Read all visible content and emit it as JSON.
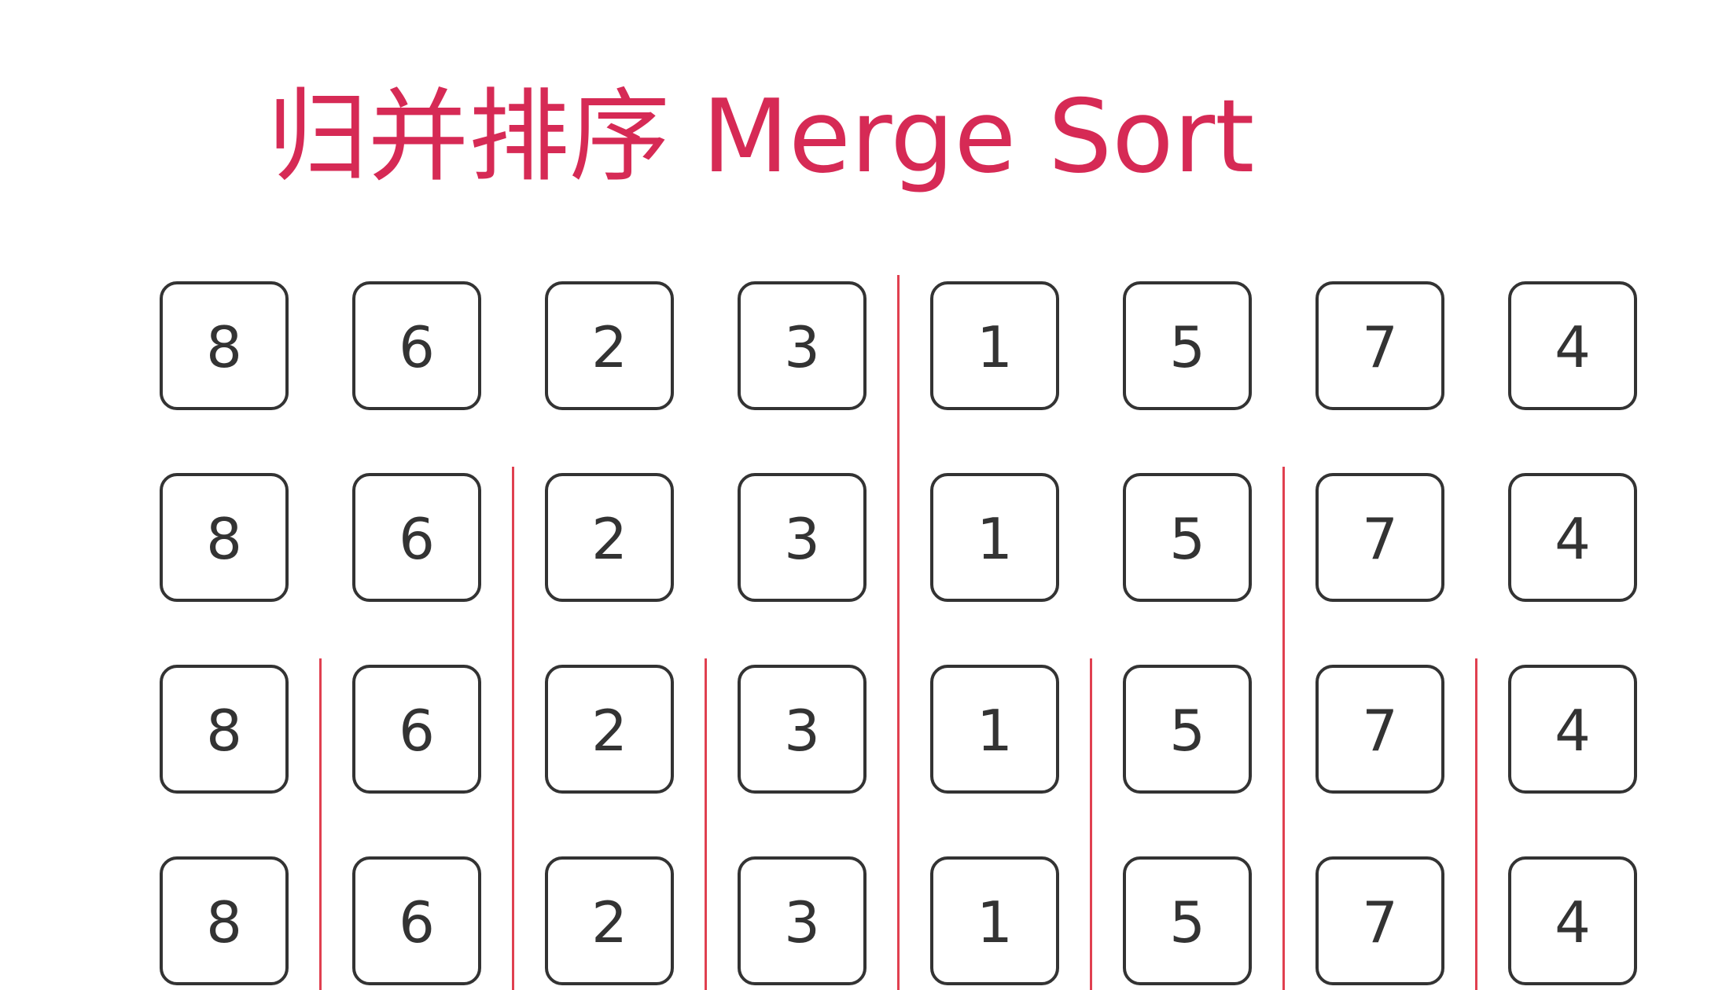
{
  "title": "归并排序 Merge Sort",
  "colors": {
    "title": "#d62a55",
    "divider": "#e04050",
    "cell_border": "#333333",
    "cell_text": "#333333"
  },
  "rows": [
    {
      "values": [
        "8",
        "6",
        "2",
        "3",
        "1",
        "5",
        "7",
        "4"
      ],
      "dividers_after": [
        4
      ]
    },
    {
      "values": [
        "8",
        "6",
        "2",
        "3",
        "1",
        "5",
        "7",
        "4"
      ],
      "dividers_after": [
        2,
        4,
        6
      ]
    },
    {
      "values": [
        "8",
        "6",
        "2",
        "3",
        "1",
        "5",
        "7",
        "4"
      ],
      "dividers_after": [
        1,
        2,
        3,
        4,
        5,
        6,
        7
      ]
    },
    {
      "values": [
        "8",
        "6",
        "2",
        "3",
        "1",
        "5",
        "7",
        "4"
      ],
      "dividers_after": [
        1,
        2,
        3,
        4,
        5,
        6,
        7
      ]
    }
  ]
}
